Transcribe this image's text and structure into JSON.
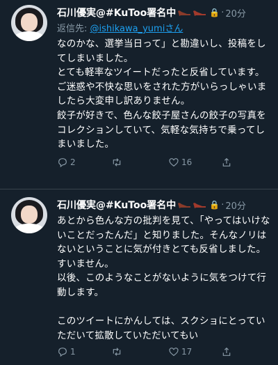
{
  "colors": {
    "background": "#15202b",
    "muted": "#8899a6",
    "link": "#1da1f2",
    "divider": "#38444d"
  },
  "tweets": [
    {
      "name": "石川優実@#KuToo署名中",
      "time": "20分",
      "reply_prefix": "返信先: ",
      "reply_to": "@ishikawa_yumiさん",
      "text": "なのかな、選挙当日って」と勘違いし、投稿をしてしまいました。\nとても軽率なツイートだったと反省しています。\nご迷惑や不快な思いをされた方がいらっしゃいましたら大変申し訳ありません。\n餃子が好きで、色んな餃子屋さんの餃子の写真をコレクションしていて、気軽な気持ちで乗ってしまいました。",
      "replies": "2",
      "retweets": "",
      "likes": "16",
      "icons": [
        "reply-icon",
        "retweet-icon",
        "like-icon",
        "share-icon"
      ]
    },
    {
      "name": "石川優実@#KuToo署名中",
      "time": "20分",
      "text": "あとから色んな方の批判を見て、「やってはいけないことだったんだ」と知りました。そんなノリはないということに気が付きとても反省しました。すいません。\n以後、このようなことがないように気をつけて行動します。\n\nこのツイートにかんしては、スクショにとっていただいて拡散していただいてもい",
      "replies": "1",
      "retweets": "",
      "likes": "17",
      "icons": [
        "reply-icon",
        "retweet-icon",
        "like-icon",
        "share-icon"
      ]
    }
  ]
}
